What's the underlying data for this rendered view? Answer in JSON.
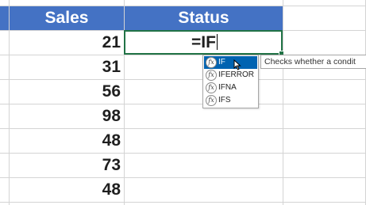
{
  "columns": {
    "sales_header": "Sales",
    "status_header": "Status"
  },
  "sales_values": [
    "21",
    "31",
    "56",
    "98",
    "48",
    "73",
    "48"
  ],
  "active_cell": {
    "formula": "=IF"
  },
  "autocomplete": {
    "items": [
      "IF",
      "IFERROR",
      "IFNA",
      "IFS"
    ],
    "selected_index": 0,
    "icon_glyph": "fx",
    "tooltip": "Checks whether a condit"
  },
  "colors": {
    "header_bg": "#4472c4",
    "selection_border": "#217346",
    "dropdown_selected": "#0063b1"
  }
}
